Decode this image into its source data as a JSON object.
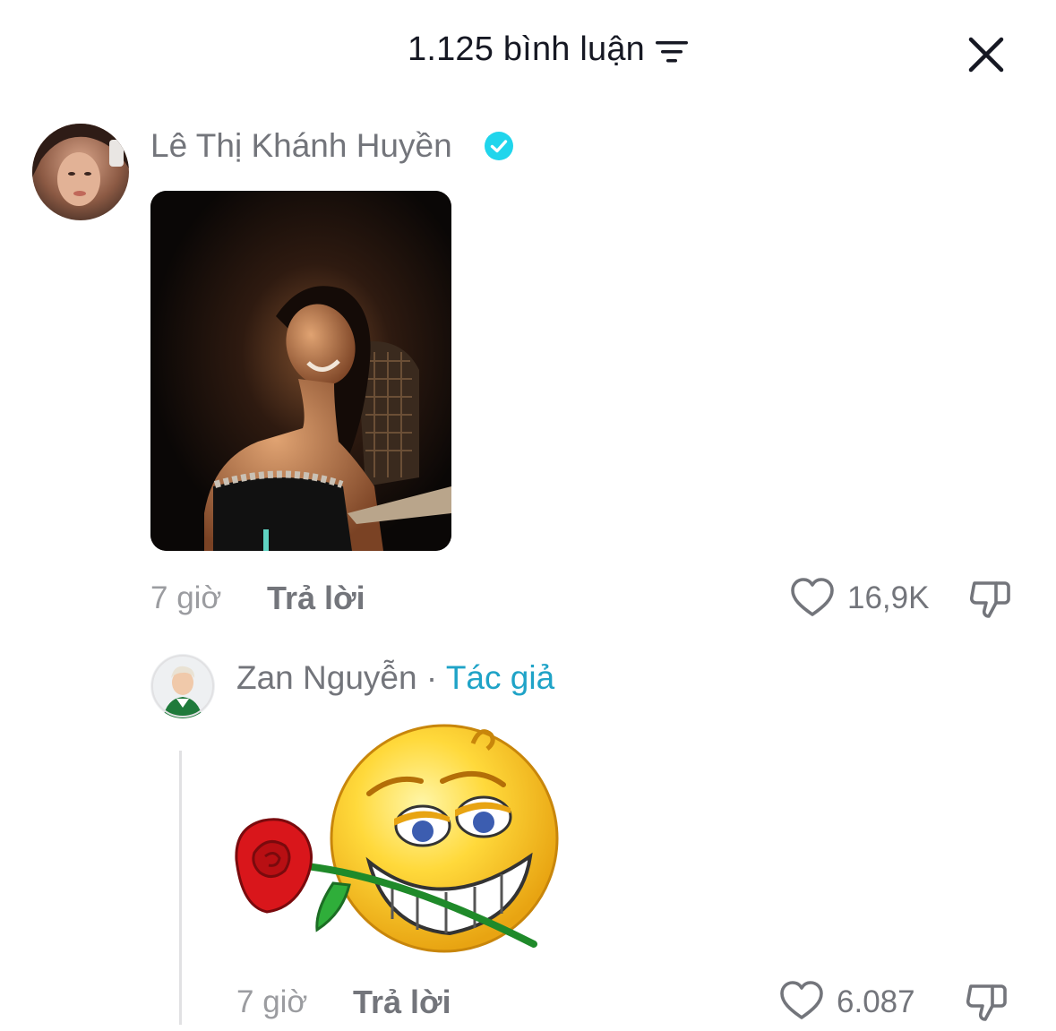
{
  "header": {
    "title": "1.125 bình luận",
    "filter_icon": "filter-icon",
    "close_icon": "close-icon"
  },
  "comments": [
    {
      "username": "Lê Thị Khánh Huyền",
      "verified": true,
      "avatar_icon": "user-avatar",
      "media": "photo",
      "time": "7 giờ",
      "reply_label": "Trả lời",
      "likes": "16,9K"
    },
    {
      "username": "Zan Nguyễn",
      "separator": "·",
      "author_badge": "Tác giả",
      "avatar_icon": "user-avatar",
      "media": "sticker-emoji-with-rose",
      "time": "7 giờ",
      "reply_label": "Trả lời",
      "likes": "6.087"
    }
  ],
  "colors": {
    "text_primary": "#161823",
    "text_secondary": "#73757b",
    "text_muted": "#9b9ca0",
    "author_accent": "#1fa3c7",
    "verified_badge": "#20d5ec"
  }
}
